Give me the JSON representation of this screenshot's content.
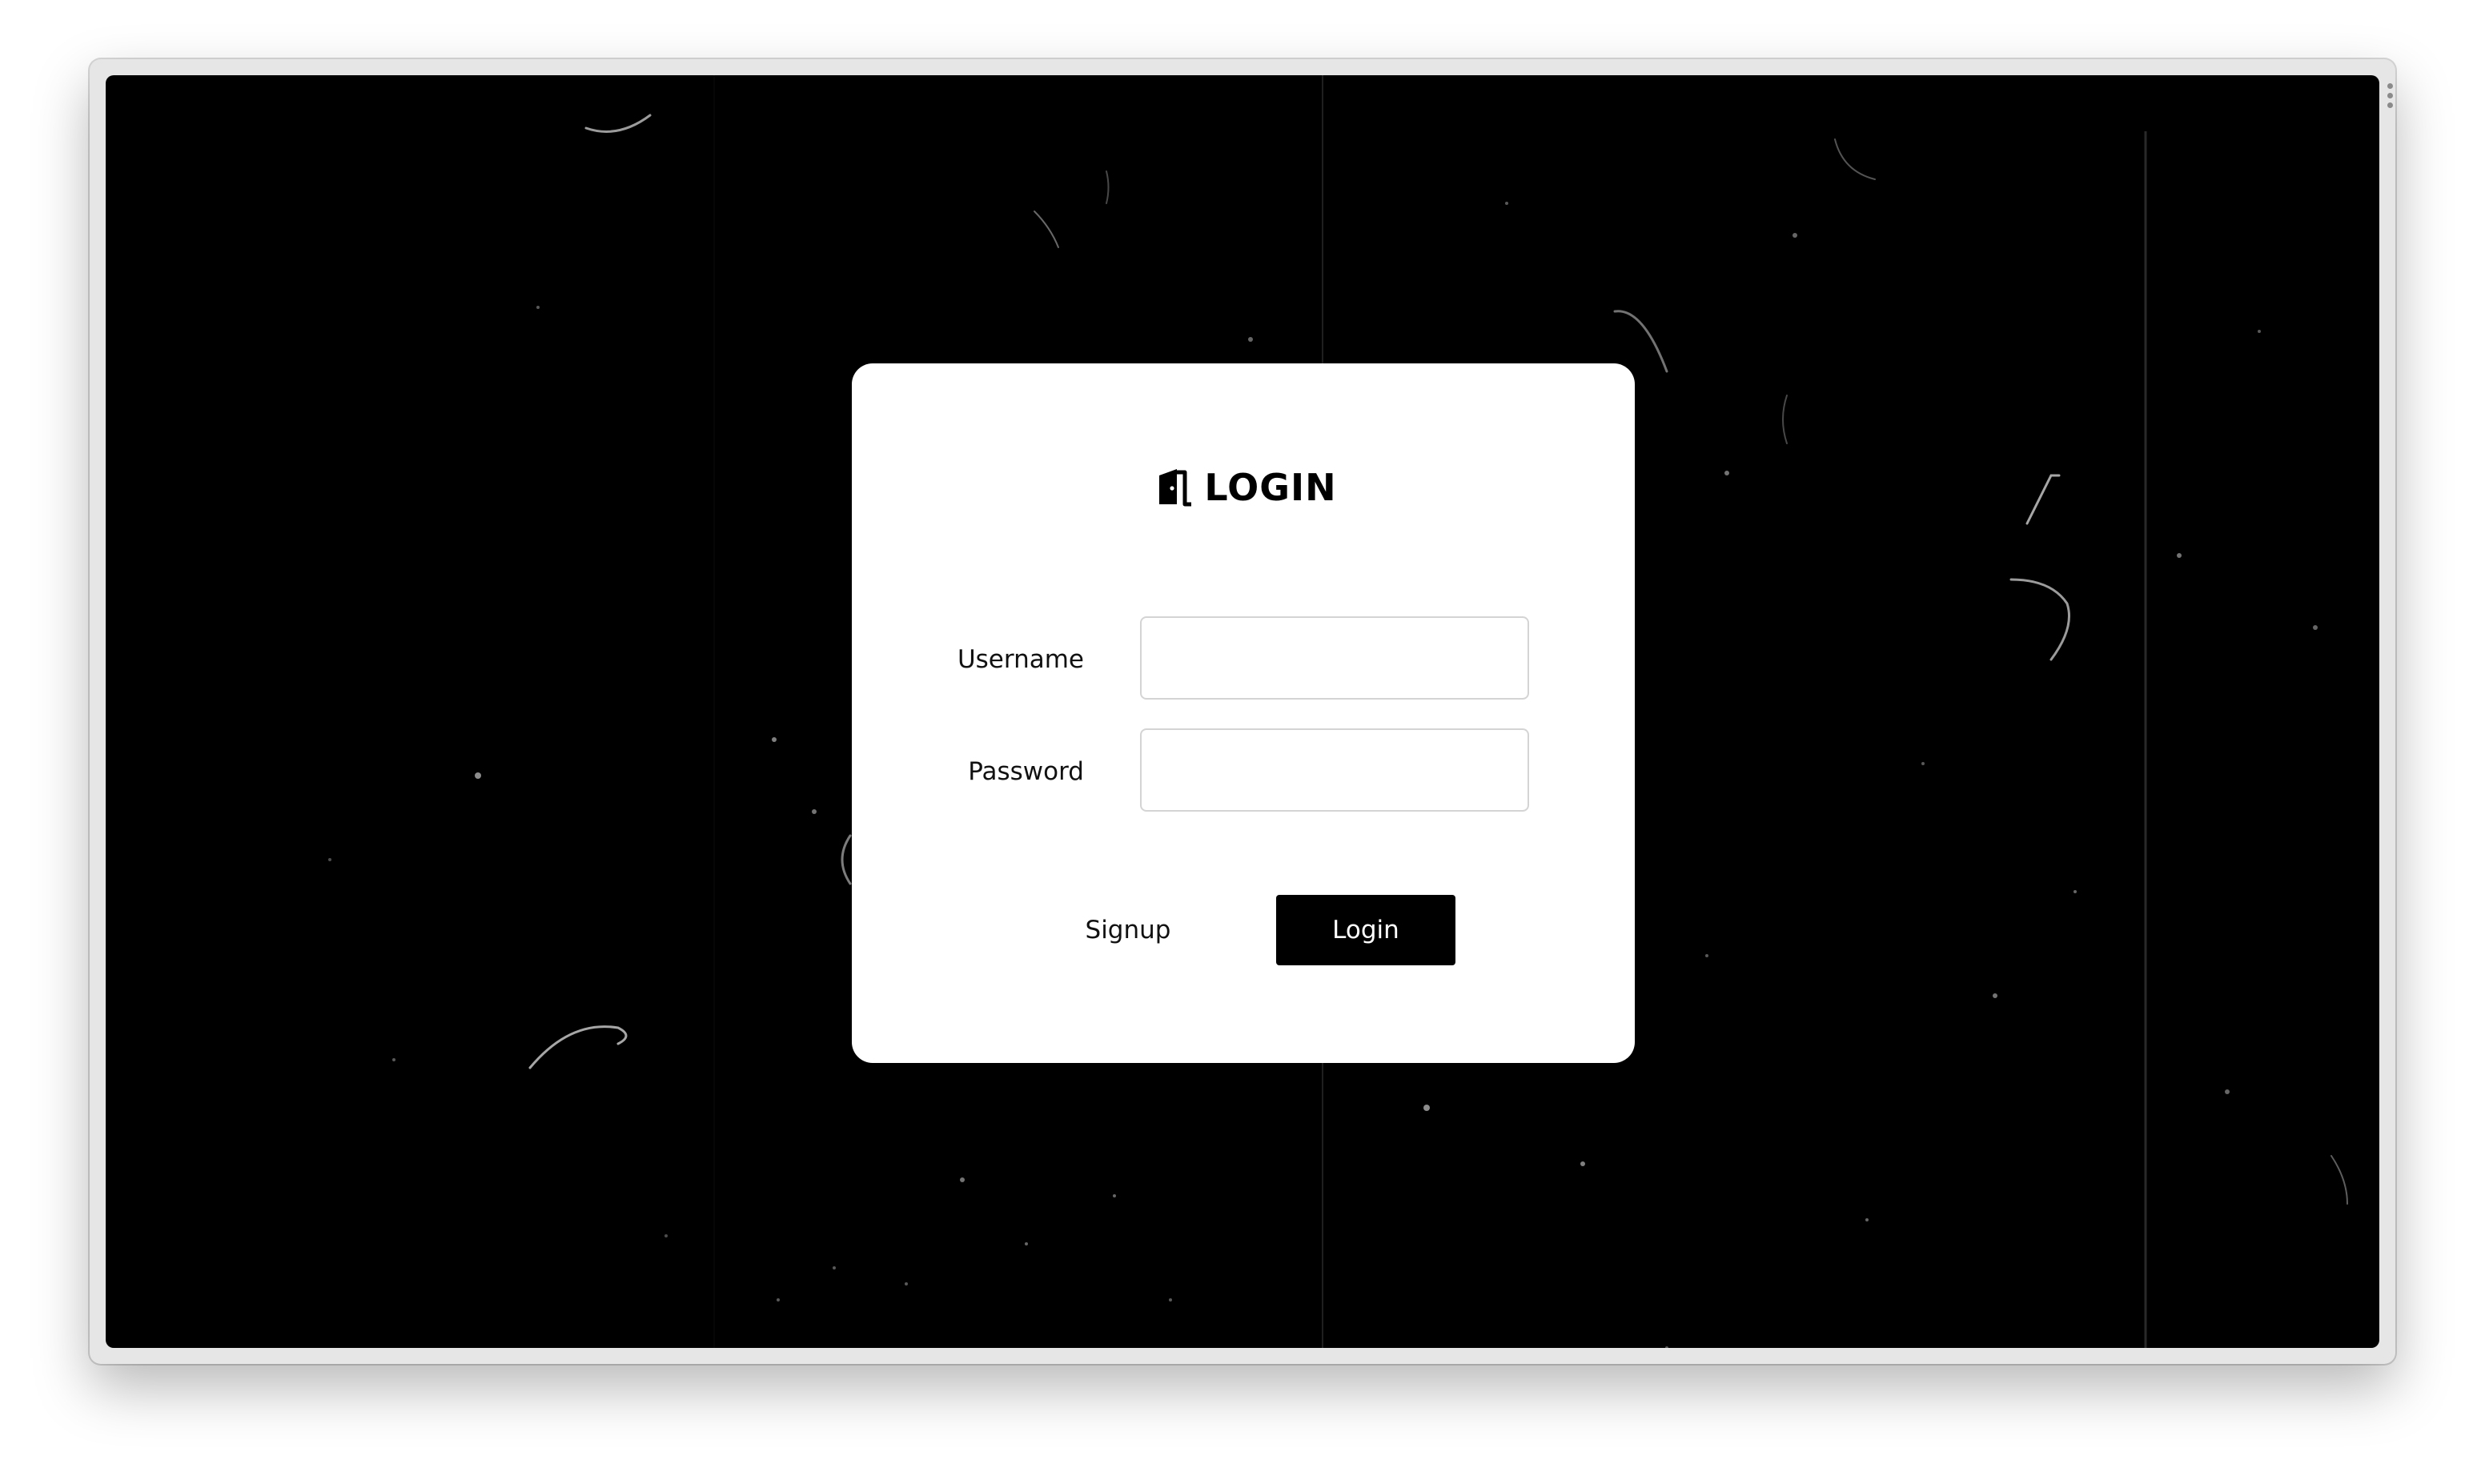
{
  "login_card": {
    "title": "LOGIN",
    "title_icon": "door-icon"
  },
  "form": {
    "username_label": "Username",
    "username_value": "",
    "password_label": "Password",
    "password_value": "",
    "signup_label": "Signup",
    "login_label": "Login"
  },
  "colors": {
    "background": "#000000",
    "card": "#ffffff",
    "button": "#000000",
    "button_text": "#ffffff"
  }
}
